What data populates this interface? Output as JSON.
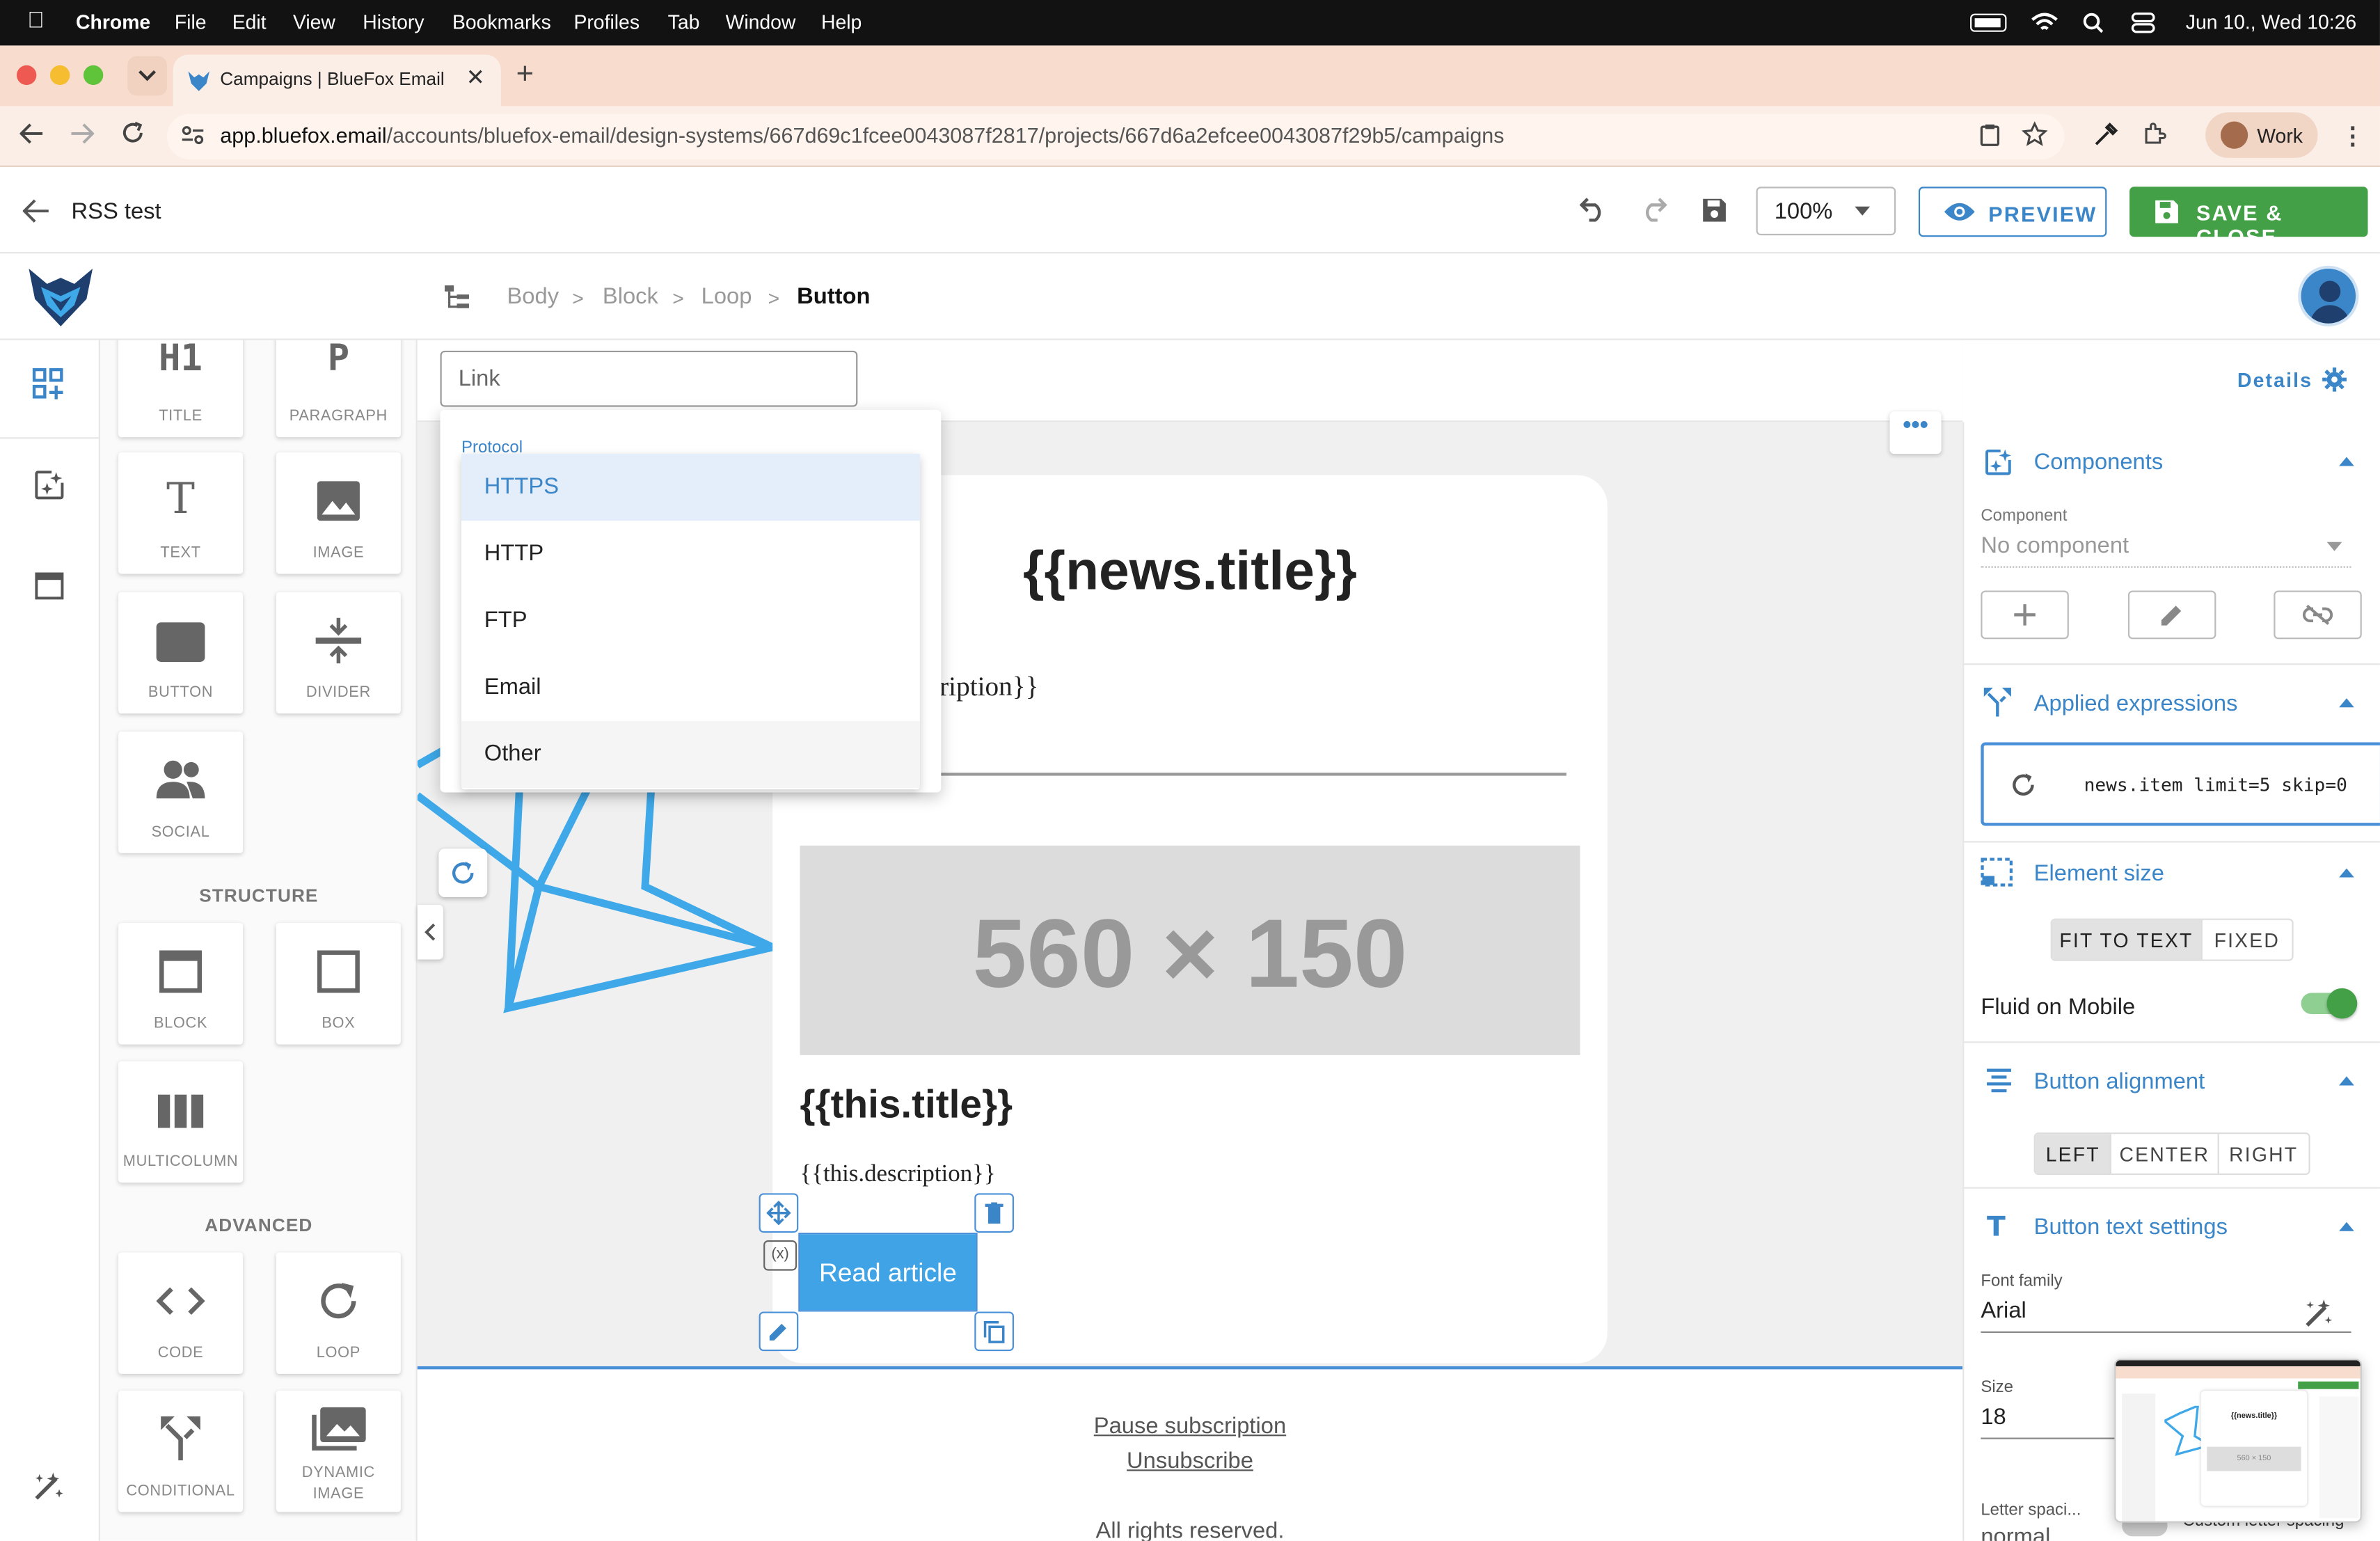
{
  "menubar": {
    "app": "Chrome",
    "items": [
      "File",
      "Edit",
      "View",
      "History",
      "Bookmarks",
      "Profiles",
      "Tab",
      "Window",
      "Help"
    ],
    "clock": "Jun 10., Wed  10:26"
  },
  "browser": {
    "tab_title": "Campaigns | BlueFox Email",
    "url_host": "app.bluefox.email",
    "url_path": "/accounts/bluefox-email/design-systems/667d69c1fcee0043087f2817/projects/667d6a2efcee0043087f29b5/campaigns",
    "profile": "Work"
  },
  "topbar": {
    "title": "RSS test",
    "zoom": "100%",
    "preview_label": "PREVIEW",
    "save_label": "SAVE & CLOSE"
  },
  "breadcrumb": [
    "Body",
    "Block",
    "Loop",
    "Button"
  ],
  "palette": {
    "title": "TITLE",
    "paragraph": "PARAGRAPH",
    "text": "TEXT",
    "image": "IMAGE",
    "button": "BUTTON",
    "divider": "DIVIDER",
    "social": "SOCIAL",
    "structure_heading": "STRUCTURE",
    "block": "BLOCK",
    "box": "BOX",
    "multicolumn": "MULTICOLUMN",
    "advanced_heading": "ADVANCED",
    "code": "CODE",
    "loop": "LOOP",
    "conditional": "CONDITIONAL",
    "dynamic_image": "DYNAMIC IMAGE",
    "h1_glyph": "H1",
    "p_glyph": "P",
    "t_glyph": "T"
  },
  "link": {
    "placeholder": "Link",
    "protocol_label": "Protocol",
    "options": [
      "HTTPS",
      "HTTP",
      "FTP",
      "Email",
      "Other"
    ],
    "selected": "HTTPS"
  },
  "canvas": {
    "news_title": "{{news.title}}",
    "news_desc": "ription}}",
    "placeholder": "560 × 150",
    "item_title": "{{this.title}}",
    "item_desc": "{{this.description}}",
    "button_text": "Read article",
    "footer": [
      "Pause subscription",
      "Unsubscribe",
      "All rights reserved."
    ]
  },
  "details_label": "Details",
  "right_panel": {
    "components_title": "Components",
    "component_label": "Component",
    "component_value": "No component",
    "expressions_title": "Applied expressions",
    "expression": "news.item limit=5 skip=0",
    "element_size_title": "Element size",
    "size_options": [
      "FIT TO TEXT",
      "FIXED"
    ],
    "fluid_label": "Fluid on Mobile",
    "alignment_title": "Button alignment",
    "align_options": [
      "LEFT",
      "CENTER",
      "RIGHT"
    ],
    "text_settings_title": "Button text settings",
    "font_family_label": "Font family",
    "font_family_value": "Arial",
    "size_label": "Size",
    "size_value": "18",
    "letter_spacing_label": "Letter spaci...",
    "letter_spacing_value": "normal",
    "custom_spacing_label": "Custom letter spacing"
  },
  "thumbnail": {
    "title": "{{news.title}}",
    "placeholder": "560 × 150"
  },
  "colors": {
    "accent": "#3b86c8",
    "save_green": "#43a047",
    "button_blue": "#3fa3e6",
    "tab_strip": "#f8dccd"
  }
}
